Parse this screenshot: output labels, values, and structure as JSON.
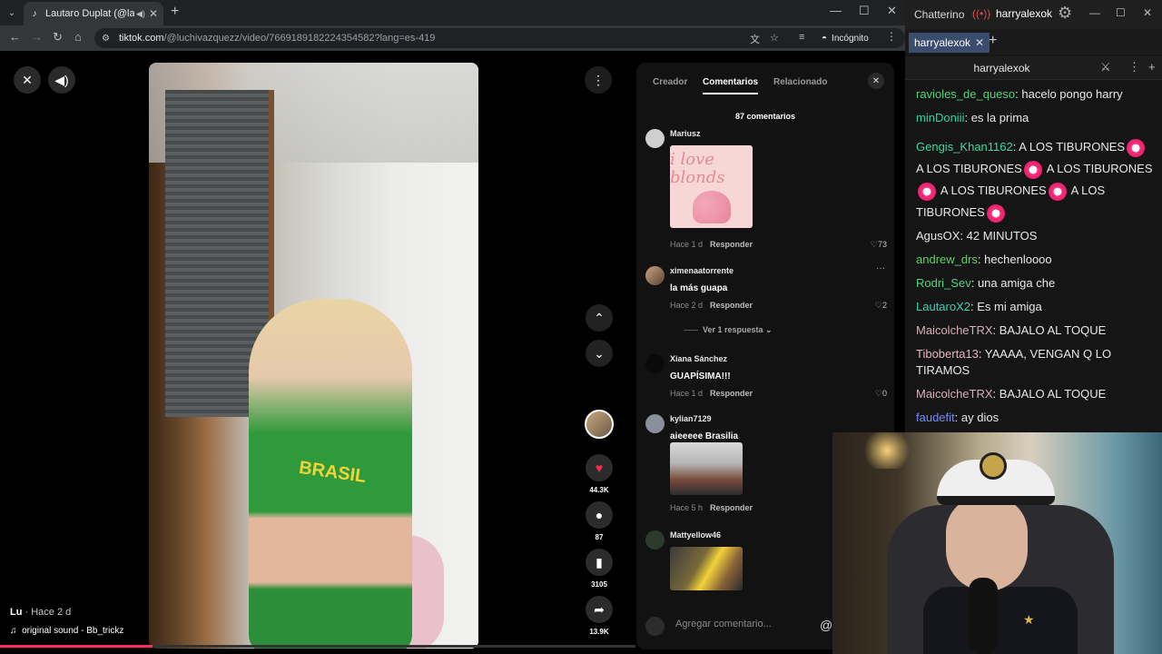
{
  "browser": {
    "tab_title": "Lautaro Duplat (@lautaro.d",
    "url_host": "tiktok.com",
    "url_path": "/@luchivazquezz/video/7669189182224354582?lang=es-419",
    "incognito_label": "Incógnito"
  },
  "video": {
    "author": "Lu",
    "posted": " · Hace 2 d",
    "sound": "original sound - Bb_trickz",
    "shirt_text": "BRASIL",
    "likes": "44.3K",
    "comments": "87",
    "saves": "3105",
    "shares": "13.9K",
    "progress": 0.24
  },
  "panel": {
    "tabs": [
      "Creador",
      "Comentarios",
      "Relacionado"
    ],
    "active_tab": "Comentarios",
    "count_label": "87 comentarios",
    "reply_label": "Responder",
    "add_placeholder": "Agregar comentario...",
    "comments": [
      {
        "user": "Mariusz",
        "text": "",
        "sticker": "i love blonds",
        "time": "Hace 1 d",
        "likes": "73"
      },
      {
        "user": "ximenaatorrente",
        "text": "la más guapa",
        "time": "Hace 2 d",
        "likes": "2",
        "replies": "Ver 1 respuesta"
      },
      {
        "user": "Xiana Sánchez",
        "text": "GUAPÍSIMA!!!",
        "time": "Hace 1 d",
        "likes": "0"
      },
      {
        "user": "kylian7129",
        "text": "aieeeee Brasilia",
        "time": "Hace 5 h",
        "likes": ""
      },
      {
        "user": "Mattyellow46",
        "text": "",
        "time": "",
        "likes": ""
      }
    ]
  },
  "chat": {
    "app_title": "Chatterino",
    "channel": "harryalexok",
    "tab_label": "harryalexok",
    "messages": [
      {
        "user": "ravioles_de_queso",
        "color": "#4dd17a",
        "text": "hacelo pongo harry"
      },
      {
        "user": "minDoniii",
        "color": "#2bd3a5",
        "text": "es la prima"
      },
      {
        "user": "Gengis_Khan1162",
        "color": "#3fd9a0",
        "text": "A LOS TIBURONES"
      },
      {
        "user": "AgusOX",
        "color": "#e8e8e8",
        "text": "42 MINUTOS"
      },
      {
        "user": "andrew_drs",
        "color": "#5ed35e",
        "text": "hechenloooo"
      },
      {
        "user": "Rodri_Sev",
        "color": "#4fd37f",
        "text": "una amiga che"
      },
      {
        "user": "LautaroX2",
        "color": "#3bd1b4",
        "text": "Es mi amiga"
      },
      {
        "user": "MaicolcheTRX",
        "color": "#d8b0b8",
        "text": "BAJALO AL TOQUE"
      },
      {
        "user": "Tiboberta13",
        "color": "#e6b5bd",
        "text": "YAAAA, VENGAN Q LO TIRAMOS"
      },
      {
        "user": "MaicolcheTRX",
        "color": "#d8b0b8",
        "text": "BAJALO AL TOQUE"
      },
      {
        "user": "faudefit",
        "color": "#6f8dff",
        "text": "ay dios"
      }
    ]
  },
  "colors": {
    "tiktok_red": "#fe2c55",
    "chat_bg": "#151515",
    "panel_bg": "#121212"
  }
}
